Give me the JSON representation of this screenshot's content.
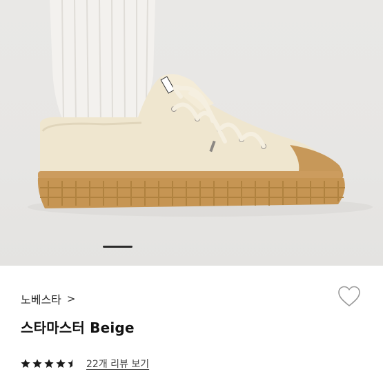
{
  "product": {
    "brand": "노베스타",
    "brand_chevron": ">",
    "name": "스타마스터 Beige",
    "rating": 4.5,
    "rating_max": 5,
    "review_link": "22개 리뷰 보기"
  },
  "gallery": {
    "active_slide_indicator": "pager-bar"
  },
  "colors": {
    "shoe_canvas": "#efe6cf",
    "shoe_sole": "#c69553",
    "sock": "#f1efec",
    "background": "#e8e7e5",
    "star": "#1a1a1a"
  }
}
